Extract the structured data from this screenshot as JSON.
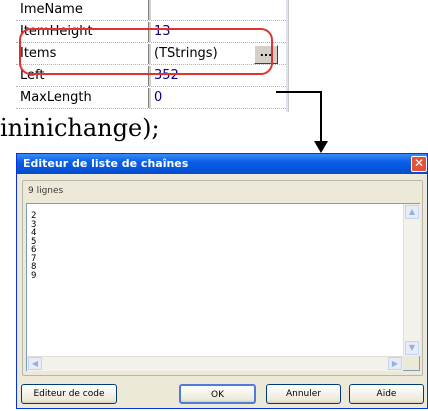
{
  "inspector": {
    "rows": [
      {
        "name": "ImeName",
        "value": ""
      },
      {
        "name": "ItemHeight",
        "value": "13"
      },
      {
        "name": "Items",
        "value": "(TStrings)"
      },
      {
        "name": "Left",
        "value": "352"
      },
      {
        "name": "MaxLength",
        "value": "0"
      }
    ],
    "ellipsis_label": "..."
  },
  "code_snippet": "ininichange);",
  "dialog": {
    "title": "Editeur de liste de chaînes",
    "close_label": "✕",
    "group_label": "9 lignes",
    "memo_lines": [
      "2",
      "3",
      "4",
      "5",
      "6",
      "7",
      "8",
      "9"
    ],
    "buttons": {
      "code_editor": "Editeur de code",
      "ok": "OK",
      "cancel": "Annuler",
      "help": "Aide"
    }
  },
  "colors": {
    "highlight": "#e0322f",
    "value_text": "#000080",
    "title_bar": "#0453d9"
  }
}
